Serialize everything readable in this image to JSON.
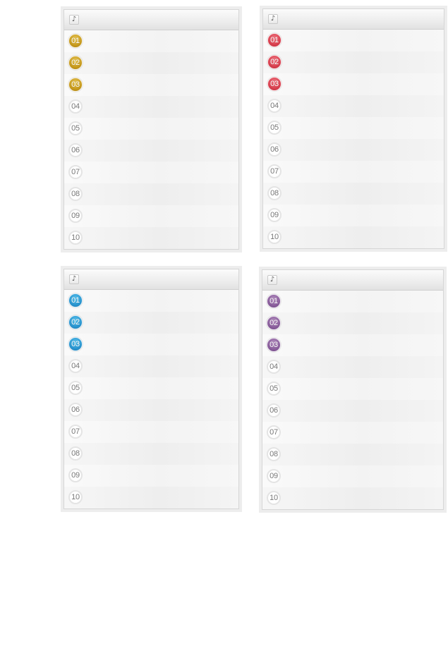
{
  "panels": [
    {
      "theme": "gold",
      "header_icon": "music-note-icon",
      "icon_glyph": "♪",
      "items": [
        "01",
        "02",
        "03",
        "04",
        "05",
        "06",
        "07",
        "08",
        "09",
        "10"
      ]
    },
    {
      "theme": "red",
      "header_icon": "music-note-icon",
      "icon_glyph": "♪",
      "items": [
        "01",
        "02",
        "03",
        "04",
        "05",
        "06",
        "07",
        "08",
        "09",
        "10"
      ]
    },
    {
      "theme": "blue",
      "header_icon": "music-note-icon",
      "icon_glyph": "♪",
      "items": [
        "01",
        "02",
        "03",
        "04",
        "05",
        "06",
        "07",
        "08",
        "09",
        "10"
      ]
    },
    {
      "theme": "purple",
      "header_icon": "music-note-icon",
      "icon_glyph": "♪",
      "items": [
        "01",
        "02",
        "03",
        "04",
        "05",
        "06",
        "07",
        "08",
        "09",
        "10"
      ]
    }
  ],
  "highlight_count": 3,
  "colors": {
    "gold": "#c79a1d",
    "red": "#d9404f",
    "blue": "#2a96d0",
    "purple": "#8a5e9c",
    "plain_badge_border": "#e4e4e4"
  }
}
